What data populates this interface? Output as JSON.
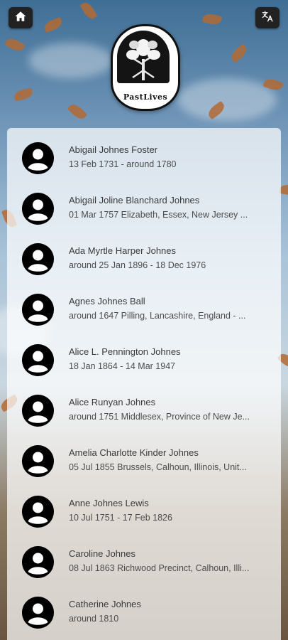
{
  "app": {
    "logo_text": "PastLives"
  },
  "icons": {
    "home": "home-icon",
    "translate": "translate-icon",
    "avatar": "person-avatar-icon"
  },
  "colors": {
    "button_bg": "#222222",
    "panel_bg": "#ffffffb8",
    "avatar": "#000000"
  },
  "people": [
    {
      "name": "Abigail Johnes Foster",
      "details": "13 Feb 1731 - around 1780"
    },
    {
      "name": "Abigail Joline Blanchard Johnes",
      "details": "01 Mar 1757 Elizabeth, Essex, New Jersey ..."
    },
    {
      "name": "Ada Myrtle Harper Johnes",
      "details": "around 25 Jan 1896 - 18 Dec 1976"
    },
    {
      "name": "Agnes Johnes Ball",
      "details": "around 1647 Pilling, Lancashire, England - ..."
    },
    {
      "name": "Alice L. Pennington Johnes",
      "details": "18 Jan 1864 - 14 Mar 1947"
    },
    {
      "name": "Alice Runyan Johnes",
      "details": "around 1751 Middlesex, Province of New Je..."
    },
    {
      "name": "Amelia Charlotte Kinder Johnes",
      "details": "05 Jul 1855 Brussels, Calhoun, Illinois, Unit..."
    },
    {
      "name": "Anne Johnes Lewis",
      "details": "10 Jul 1751 - 17 Feb 1826"
    },
    {
      "name": "Caroline Johnes",
      "details": "08 Jul 1863 Richwood Precinct, Calhoun, Illi..."
    },
    {
      "name": "Catherine Johnes",
      "details": "around 1810"
    }
  ]
}
